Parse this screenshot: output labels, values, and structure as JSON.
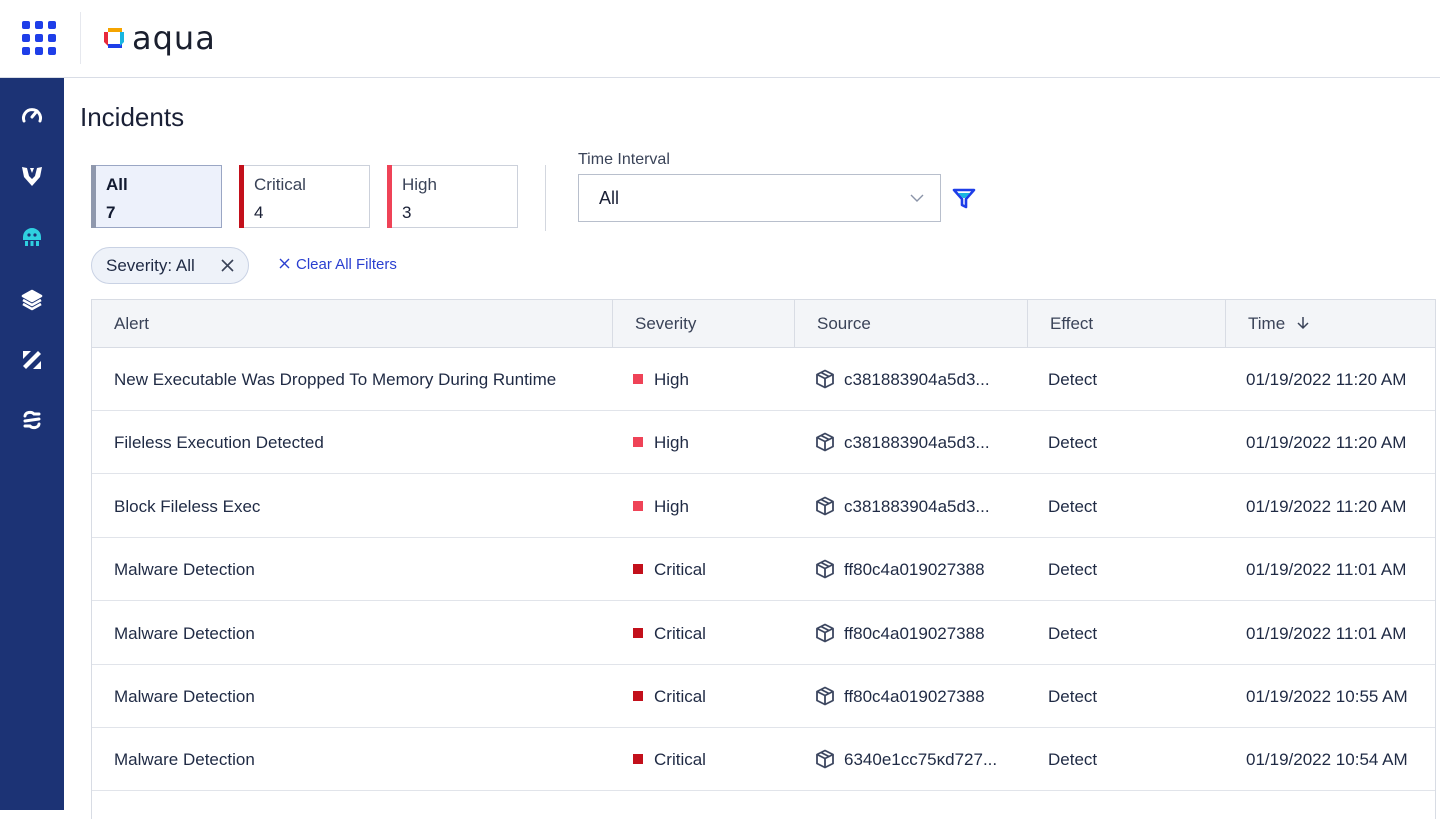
{
  "header": {
    "logo_text": "aqua",
    "brand_colors": [
      "#f5a400",
      "#e8293b",
      "#1e3ee8",
      "#19b6e0"
    ]
  },
  "nav": {
    "items": [
      {
        "icon": "speedometer-icon",
        "active": false
      },
      {
        "icon": "shield-wings-icon",
        "active": false
      },
      {
        "icon": "incident-bug-icon",
        "active": true
      },
      {
        "icon": "layers-icon",
        "active": false
      },
      {
        "icon": "percent-icon",
        "active": false
      },
      {
        "icon": "link-icon",
        "active": false
      }
    ],
    "bg_color": "#1c3375",
    "active_color": "#2fd0e0"
  },
  "page": {
    "title": "Incidents"
  },
  "severity_cards": [
    {
      "label": "All",
      "count": "7",
      "color": "#8f98ad",
      "active": true
    },
    {
      "label": "Critical",
      "count": "4",
      "color": "#c3101b",
      "active": false
    },
    {
      "label": "High",
      "count": "3",
      "color": "#ef4357",
      "active": false
    }
  ],
  "time_interval": {
    "label": "Time Interval",
    "value": "All"
  },
  "filters": {
    "chip_label": "Severity: All",
    "clear_label": "Clear All Filters"
  },
  "table": {
    "columns": [
      "Alert",
      "Severity",
      "Source",
      "Effect",
      "Time"
    ],
    "sort": {
      "column": "Time",
      "direction": "desc"
    },
    "rows": [
      {
        "alert": "New Executable Was Dropped To Memory During Runtime",
        "severity": "High",
        "source": "c381883904a5d3...",
        "effect": "Detect",
        "time": "01/19/2022 11:20 AM"
      },
      {
        "alert": "Fileless Execution Detected",
        "severity": "High",
        "source": "c381883904a5d3...",
        "effect": "Detect",
        "time": "01/19/2022 11:20 AM"
      },
      {
        "alert": "Block Fileless Exec",
        "severity": "High",
        "source": "c381883904a5d3...",
        "effect": "Detect",
        "time": "01/19/2022 11:20 AM"
      },
      {
        "alert": "Malware Detection",
        "severity": "Critical",
        "source": "ff80c4a019027388",
        "effect": "Detect",
        "time": "01/19/2022 11:01 AM"
      },
      {
        "alert": "Malware Detection",
        "severity": "Critical",
        "source": "ff80c4a019027388",
        "effect": "Detect",
        "time": "01/19/2022 11:01 AM"
      },
      {
        "alert": "Malware Detection",
        "severity": "Critical",
        "source": "ff80c4a019027388",
        "effect": "Detect",
        "time": "01/19/2022 10:55 AM"
      },
      {
        "alert": "Malware Detection",
        "severity": "Critical",
        "source": "6340e1cc75ĸd727...",
        "effect": "Detect",
        "time": "01/19/2022 10:54 AM"
      }
    ]
  },
  "severity_colors": {
    "High": "#ef4357",
    "Critical": "#c3101b"
  }
}
